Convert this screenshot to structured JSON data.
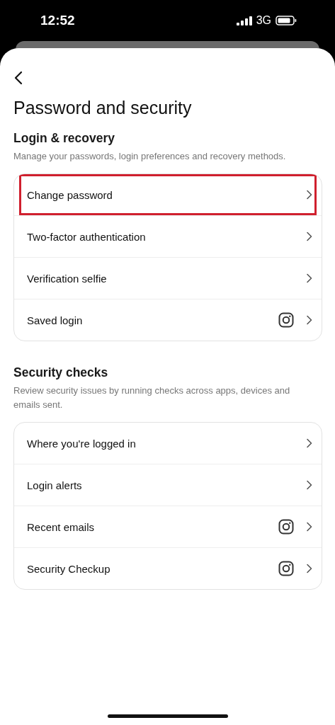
{
  "status_bar": {
    "time": "12:52",
    "network": "3G"
  },
  "title": "Password and security",
  "sections": [
    {
      "heading": "Login & recovery",
      "description": "Manage your passwords, login preferences and recovery methods.",
      "items": [
        {
          "label": "Change password",
          "app_icon": false,
          "highlighted": true
        },
        {
          "label": "Two-factor authentication",
          "app_icon": false,
          "highlighted": false
        },
        {
          "label": "Verification selfie",
          "app_icon": false,
          "highlighted": false
        },
        {
          "label": "Saved login",
          "app_icon": true,
          "highlighted": false
        }
      ]
    },
    {
      "heading": "Security checks",
      "description": "Review security issues by running checks across apps, devices and emails sent.",
      "items": [
        {
          "label": "Where you're logged in",
          "app_icon": false,
          "highlighted": false
        },
        {
          "label": "Login alerts",
          "app_icon": false,
          "highlighted": false
        },
        {
          "label": "Recent emails",
          "app_icon": true,
          "highlighted": false
        },
        {
          "label": "Security Checkup",
          "app_icon": true,
          "highlighted": false
        }
      ]
    }
  ]
}
